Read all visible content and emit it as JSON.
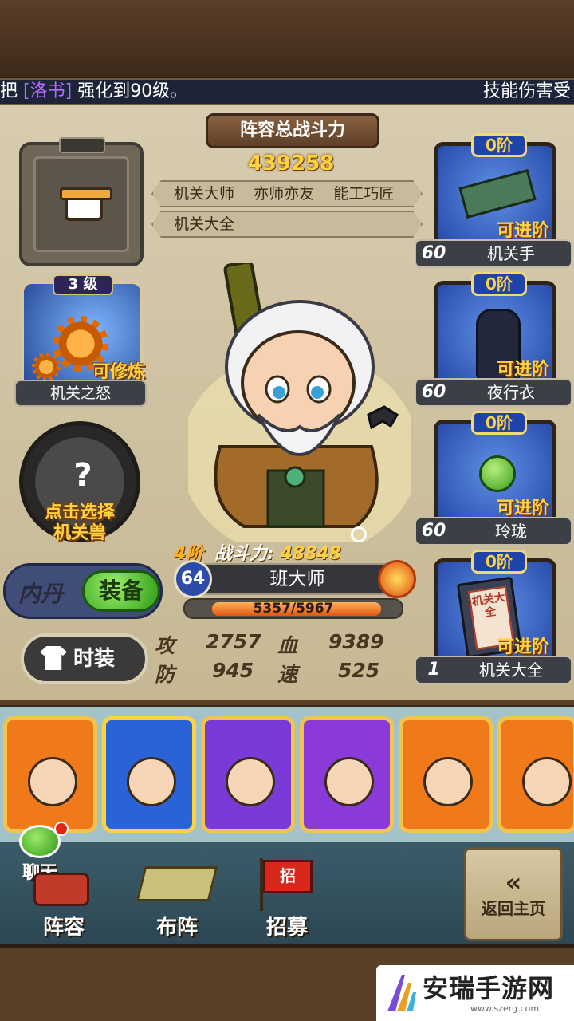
{
  "marquee": {
    "prefix": "把",
    "highlight": "[洛书]",
    "suffix": "强化到90级。",
    "right": "技能伤害受"
  },
  "power": {
    "banner": "阵容总战斗力",
    "value": "439258"
  },
  "tags": {
    "row1": [
      "机关大师",
      "亦师亦友",
      "能工巧匠"
    ],
    "row2": "机关大全"
  },
  "left": {
    "skill": {
      "level_num": "3",
      "level_unit": "级",
      "status": "可修炼",
      "name": "机关之怒"
    },
    "beast": {
      "mark": "?",
      "prompt_line1": "点击选择",
      "prompt_line2": "机关兽"
    },
    "neidan": {
      "label": "内丹",
      "button": "装备"
    },
    "outfit": {
      "label": "时装"
    }
  },
  "hero": {
    "grade": "4阶",
    "power_label": "战斗力:",
    "power_value": "48848",
    "level": "64",
    "name": "班大师",
    "exp_text": "5357/5967",
    "exp_fraction": 0.897,
    "stats": [
      {
        "key": "攻",
        "value": "2757"
      },
      {
        "key": "血",
        "value": "9389"
      },
      {
        "key": "防",
        "value": "945"
      },
      {
        "key": "速",
        "value": "525"
      }
    ]
  },
  "equipment": [
    {
      "stage": "0阶",
      "level": "60",
      "name": "机关手",
      "status": "可进阶"
    },
    {
      "stage": "0阶",
      "level": "60",
      "name": "夜行衣",
      "status": "可进阶"
    },
    {
      "stage": "0阶",
      "level": "60",
      "name": "玲珑",
      "status": "可进阶"
    },
    {
      "stage": "0阶",
      "level": "1",
      "name": "机关大全",
      "status": "可进阶",
      "book_title": "机关大全"
    }
  ],
  "nav": {
    "chat": "聊天",
    "lineup": "阵容",
    "formation": "布阵",
    "recruit": "招募",
    "back_arrow": "«",
    "back": "返回主页",
    "recruit_flag": "招"
  },
  "watermark": {
    "title": "安瑞手游网",
    "url": "www.szerg.com"
  },
  "colors": {
    "gold": "#ffd23f",
    "panel": "#d7ccb0",
    "wood": "#5a3f29",
    "blue": "#2043a8",
    "green": "#2d9a15"
  }
}
